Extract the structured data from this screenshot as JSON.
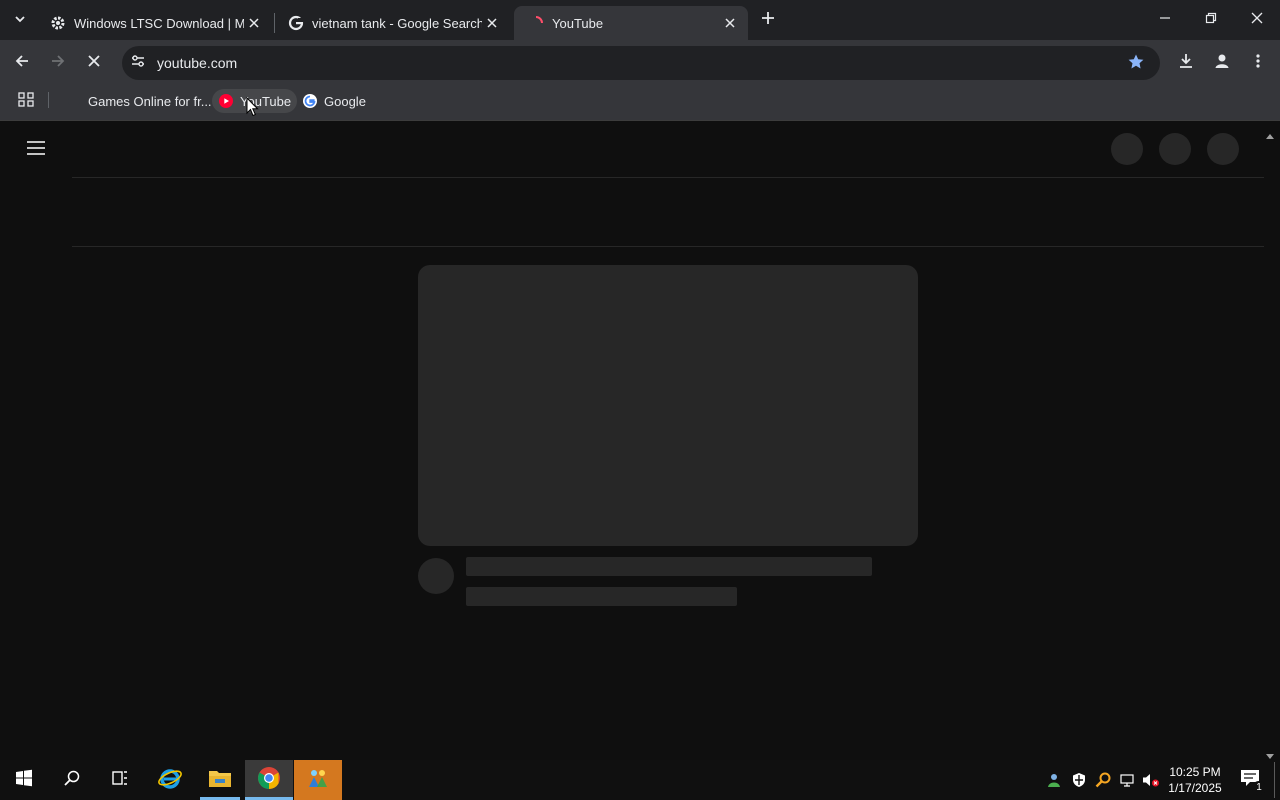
{
  "tabs": [
    {
      "title": "Windows LTSC Download | MAS",
      "icon": "gear-icon",
      "active": false
    },
    {
      "title": "vietnam tank - Google Search",
      "icon": "google-icon",
      "active": false
    },
    {
      "title": "YouTube",
      "icon": "youtube-icon",
      "active": true
    }
  ],
  "omnibox": {
    "url": "youtube.com"
  },
  "bookmarks": [
    {
      "label": "Games Online for fr..."
    },
    {
      "label": "YouTube"
    },
    {
      "label": "Google"
    }
  ],
  "taskbar": {
    "time": "10:25 PM",
    "date": "1/17/2025",
    "notification_count": "1"
  },
  "colors": {
    "youtube_red": "#ff0033",
    "skeleton": "#272727",
    "page_bg": "#0f0f0f",
    "chrome_toolbar": "#35363a",
    "star_blue": "#8ab4f8"
  }
}
